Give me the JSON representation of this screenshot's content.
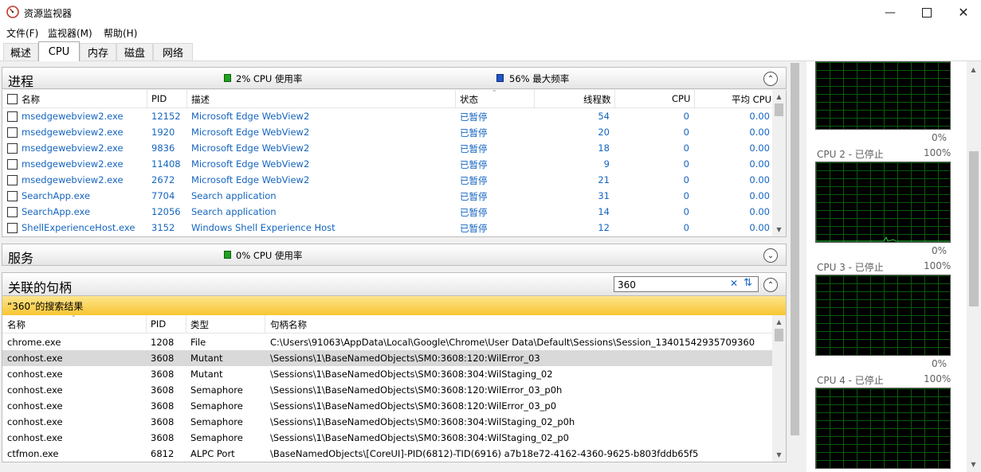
{
  "window": {
    "title": "资源监视器"
  },
  "menu": [
    {
      "label": "文件(F)"
    },
    {
      "label": "监视器(M)"
    },
    {
      "label": "帮助(H)"
    }
  ],
  "tabs": [
    {
      "label": "概述"
    },
    {
      "label": "CPU"
    },
    {
      "label": "内存"
    },
    {
      "label": "磁盘"
    },
    {
      "label": "网络"
    }
  ],
  "processes": {
    "title": "进程",
    "cpu_usage": "2% CPU 使用率",
    "max_freq": "56% 最大频率",
    "columns": {
      "name": "名称",
      "pid": "PID",
      "desc": "描述",
      "status": "状态",
      "threads": "线程数",
      "cpu": "CPU",
      "avgcpu": "平均 CPU"
    },
    "rows": [
      {
        "name": "msedgewebview2.exe",
        "pid": "12152",
        "desc": "Microsoft Edge WebView2",
        "status": "已暂停",
        "threads": "54",
        "cpu": "0",
        "avgcpu": "0.00"
      },
      {
        "name": "msedgewebview2.exe",
        "pid": "1920",
        "desc": "Microsoft Edge WebView2",
        "status": "已暂停",
        "threads": "20",
        "cpu": "0",
        "avgcpu": "0.00"
      },
      {
        "name": "msedgewebview2.exe",
        "pid": "9836",
        "desc": "Microsoft Edge WebView2",
        "status": "已暂停",
        "threads": "18",
        "cpu": "0",
        "avgcpu": "0.00"
      },
      {
        "name": "msedgewebview2.exe",
        "pid": "11408",
        "desc": "Microsoft Edge WebView2",
        "status": "已暂停",
        "threads": "9",
        "cpu": "0",
        "avgcpu": "0.00"
      },
      {
        "name": "msedgewebview2.exe",
        "pid": "2672",
        "desc": "Microsoft Edge WebView2",
        "status": "已暂停",
        "threads": "21",
        "cpu": "0",
        "avgcpu": "0.00"
      },
      {
        "name": "SearchApp.exe",
        "pid": "7704",
        "desc": "Search application",
        "status": "已暂停",
        "threads": "31",
        "cpu": "0",
        "avgcpu": "0.00"
      },
      {
        "name": "SearchApp.exe",
        "pid": "12056",
        "desc": "Search application",
        "status": "已暂停",
        "threads": "14",
        "cpu": "0",
        "avgcpu": "0.00"
      },
      {
        "name": "ShellExperienceHost.exe",
        "pid": "3152",
        "desc": "Windows Shell Experience Host",
        "status": "已暂停",
        "threads": "12",
        "cpu": "0",
        "avgcpu": "0.00"
      }
    ]
  },
  "services": {
    "title": "服务",
    "cpu_usage": "0% CPU 使用率"
  },
  "handles": {
    "title": "关联的句柄",
    "search_value": "360",
    "result_banner": "“360”的搜索结果",
    "columns": {
      "name": "名称",
      "pid": "PID",
      "type": "类型",
      "handle": "句柄名称"
    },
    "rows": [
      {
        "name": "chrome.exe",
        "pid": "1208",
        "type": "File",
        "handle": "C:\\Users\\91063\\AppData\\Local\\Google\\Chrome\\User Data\\Default\\Sessions\\Session_13401542935709360"
      },
      {
        "name": "conhost.exe",
        "pid": "3608",
        "type": "Mutant",
        "handle": "\\Sessions\\1\\BaseNamedObjects\\SM0:3608:120:WilError_03"
      },
      {
        "name": "conhost.exe",
        "pid": "3608",
        "type": "Mutant",
        "handle": "\\Sessions\\1\\BaseNamedObjects\\SM0:3608:304:WilStaging_02"
      },
      {
        "name": "conhost.exe",
        "pid": "3608",
        "type": "Semaphore",
        "handle": "\\Sessions\\1\\BaseNamedObjects\\SM0:3608:120:WilError_03_p0h"
      },
      {
        "name": "conhost.exe",
        "pid": "3608",
        "type": "Semaphore",
        "handle": "\\Sessions\\1\\BaseNamedObjects\\SM0:3608:120:WilError_03_p0"
      },
      {
        "name": "conhost.exe",
        "pid": "3608",
        "type": "Semaphore",
        "handle": "\\Sessions\\1\\BaseNamedObjects\\SM0:3608:304:WilStaging_02_p0h"
      },
      {
        "name": "conhost.exe",
        "pid": "3608",
        "type": "Semaphore",
        "handle": "\\Sessions\\1\\BaseNamedObjects\\SM0:3608:304:WilStaging_02_p0"
      },
      {
        "name": "ctfmon.exe",
        "pid": "6812",
        "type": "ALPC Port",
        "handle": "\\BaseNamedObjects\\[CoreUI]-PID(6812)-TID(6916) a7b18e72-4162-4360-9625-b803fddb65f5"
      }
    ]
  },
  "graphs": {
    "top_label": "0%",
    "cpus": [
      {
        "label": "CPU 2 - 已停止",
        "max": "100%",
        "min": "0%"
      },
      {
        "label": "CPU 3 - 已停止",
        "max": "100%",
        "min": "0%"
      },
      {
        "label": "CPU 4 - 已停止",
        "max": "100%"
      }
    ]
  },
  "colors": {
    "accent_blue": "#1565c0",
    "banner": "#fbd24e",
    "cpu_green": "#1fa31f",
    "freq_blue": "#2154c9"
  }
}
